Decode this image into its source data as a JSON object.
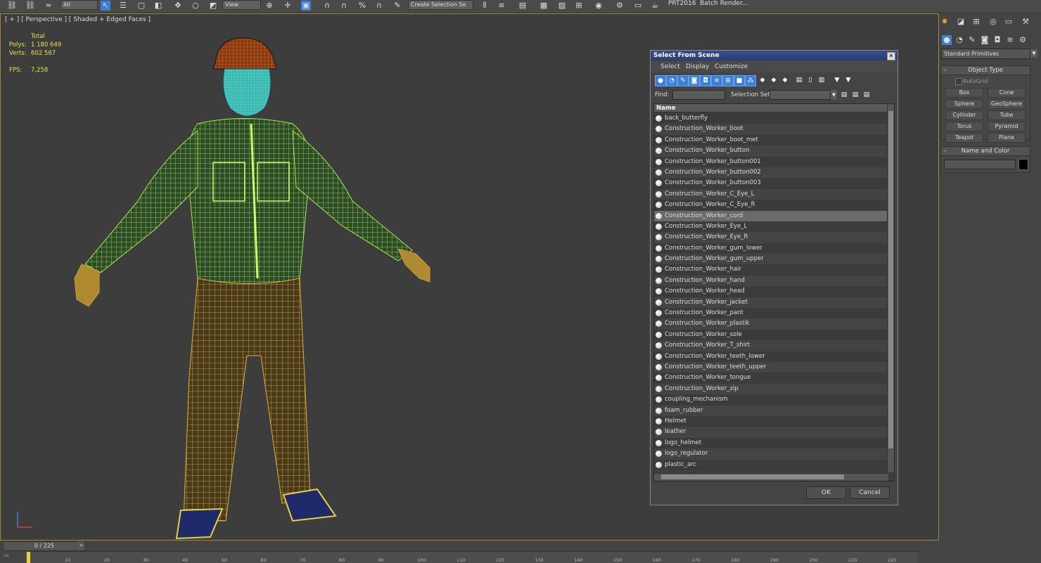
{
  "toolbar": {
    "icons": [
      "link-icon",
      "unlink-icon",
      "bind-space-warp-icon",
      "select-object-icon",
      "select-by-name-icon",
      "region-select-icon",
      "window-crossing-icon",
      "move-icon",
      "rotate-icon",
      "scale-icon",
      "pivot-icon",
      "snap-icon",
      "angle-snap-icon",
      "percent-snap-icon",
      "spinner-snap-icon",
      "edit-named-selection-icon",
      "mirror-icon",
      "align-icon",
      "layer-manager-icon",
      "scene-explorer-icon",
      "curve-editor-icon",
      "schematic-view-icon",
      "material-editor-icon",
      "render-setup-icon",
      "rendered-frame-icon",
      "render-icon"
    ],
    "filter_dropdown": "All",
    "coord_dropdown": "View",
    "named_selection": "Create Selection Se",
    "plugin_label": "PRT2016",
    "batch_render_label": "Batch Render..."
  },
  "viewport": {
    "label": "[ + ] [ Perspective ] [ Shaded + Edged Faces ]",
    "stats": {
      "total_label": "Total",
      "polys_label": "Polys:",
      "polys_value": "1 180 649",
      "verts_label": "Verts:",
      "verts_value": "602 567",
      "fps_label": "FPS:",
      "fps_value": "7,258"
    }
  },
  "command_panel": {
    "tab_icons": [
      "create-icon",
      "modify-icon",
      "hierarchy-icon",
      "motion-icon",
      "display-icon",
      "utilities-icon"
    ],
    "sub_icons": [
      "geometry-icon",
      "shapes-icon",
      "lights-icon",
      "cameras-icon",
      "helpers-icon",
      "space-warps-icon",
      "systems-icon"
    ],
    "primitive_type": "Standard Primitives",
    "object_type_title": "Object Type",
    "autogrid_label": "AutoGrid",
    "primitives": [
      "Box",
      "Cone",
      "Sphere",
      "GeoSphere",
      "Cylinder",
      "Tube",
      "Torus",
      "Pyramid",
      "Teapot",
      "Plane"
    ],
    "name_color_title": "Name and Color",
    "object_color": "#000000"
  },
  "dialog": {
    "title": "Select From Scene",
    "menu": [
      "Select",
      "Display",
      "Customize"
    ],
    "find_label": "Find:",
    "selection_set_label": "Selection Set:",
    "column_name": "Name",
    "selected_index": 9,
    "items": [
      "back_butterfly",
      "Construction_Worker_boot",
      "Construction_Worker_boot_met",
      "Construction_Worker_button",
      "Construction_Worker_button001",
      "Construction_Worker_button002",
      "Construction_Worker_button003",
      "Construction_Worker_C_Eye_L",
      "Construction_Worker_C_Eye_R",
      "Construction_Worker_cord",
      "Construction_Worker_Eye_L",
      "Construction_Worker_Eye_R",
      "Construction_Worker_gum_lower",
      "Construction_Worker_gum_upper",
      "Construction_Worker_hair",
      "Construction_Worker_hand",
      "Construction_Worker_head",
      "Construction_Worker_jacket",
      "Construction_Worker_pant",
      "Construction_Worker_plastik",
      "Construction_Worker_sole",
      "Construction_Worker_T_shirt",
      "Construction_Worker_teeth_lower",
      "Construction_Worker_teeth_upper",
      "Construction_Worker_tongue",
      "Construction_Worker_zip",
      "coupling_mechanism",
      "foam_rubber",
      "Helmet",
      "leather",
      "logo_helmet",
      "logo_regulator",
      "plastic_arc"
    ],
    "ok_label": "OK",
    "cancel_label": "Cancel"
  },
  "timeline": {
    "frame_display": "0 / 225",
    "prev_arrow": "<",
    "next_arrow": ">",
    "ticks": [
      "10",
      "20",
      "30",
      "40",
      "50",
      "60",
      "70",
      "80",
      "90",
      "100",
      "110",
      "120",
      "130",
      "140",
      "150",
      "160",
      "170",
      "180",
      "190",
      "200",
      "210",
      "220"
    ]
  }
}
